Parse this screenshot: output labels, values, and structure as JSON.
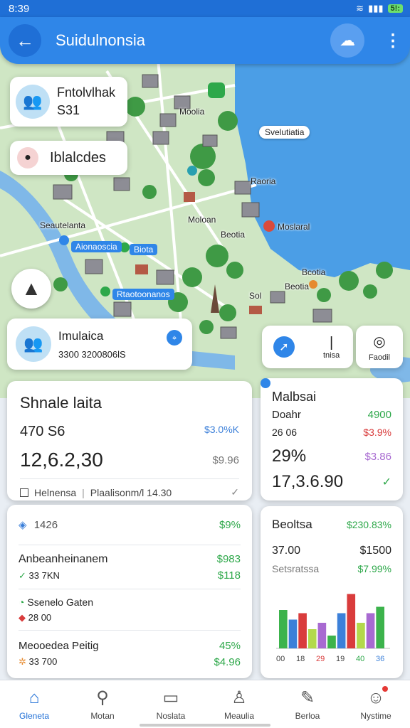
{
  "status": {
    "time": "8:39",
    "battery": "5!:"
  },
  "header": {
    "title": "Suidulnonsia"
  },
  "map": {
    "labels": [
      "Moolia",
      "Svelutiatia",
      "Raoria",
      "Moloan",
      "Beotia",
      "Moslaral",
      "Seautelanta",
      "Bcotia",
      "Beotia",
      "Sol"
    ],
    "pills": [
      "Aionaoscia",
      "Rtaotoonanos"
    ],
    "pill_small": "Biota"
  },
  "card_person": {
    "name": "Fntolvlhak",
    "value": "S31"
  },
  "card_place": {
    "name": "Iblalcdes"
  },
  "card_user": {
    "name": "Imulaica",
    "sub": "3300 3200806lS"
  },
  "card_right": {
    "label": "tnisa",
    "label2": "Faodil"
  },
  "summary": {
    "title": "Shnale laita",
    "row1_left": "470 S6",
    "row1_right": "$3.0%K",
    "big_value": "12,6.2,30",
    "big_right": "$9.96",
    "footer_left": "Helnensa",
    "footer_right": "Plaalisonm/l 14.30"
  },
  "market": {
    "title": "Malbsai",
    "line1_label": "Doahr",
    "line1_value": "4900",
    "line2_left": "26 06",
    "line2_right": "$3.9%",
    "percent": "29%",
    "percent_right": "$3.86",
    "big_value": "17,3.6.90"
  },
  "list": {
    "header_left": "1426",
    "header_right": "$9%",
    "items": [
      {
        "title": "Anbeanheinanem",
        "sub": "33 7KN",
        "v1": "$983",
        "v2": "$118"
      },
      {
        "title": "Ssenelo Gaten",
        "sub": "28 00",
        "v1": "",
        "v2": ""
      },
      {
        "title": "Meooedea Peitig",
        "sub": "33 700",
        "v1": "45%",
        "v2": "$4.96"
      }
    ]
  },
  "stats": {
    "title": "Beoltsa",
    "title_value": "$230.83%",
    "v1": "37.00",
    "v1_right": "$1500",
    "sub": "Setsratssa",
    "sub_right": "$7.99%",
    "axis": [
      "00",
      "18",
      "29",
      "19",
      "40",
      "36"
    ]
  },
  "chart_data": {
    "type": "bar",
    "categories": [
      "00",
      "18",
      "29",
      "19",
      "40",
      "36"
    ],
    "series": [
      {
        "values": [
          60,
          45,
          55,
          30,
          40,
          20,
          55,
          85,
          40,
          55,
          65
        ]
      }
    ],
    "colors": [
      "#3cb34c",
      "#3c80d9",
      "#d93c3c",
      "#b3d94c",
      "#a86ad1"
    ],
    "ylim": [
      0,
      100
    ]
  },
  "nav": [
    {
      "label": "Gleneta",
      "icon": "home-icon"
    },
    {
      "label": "Motan",
      "icon": "search-icon"
    },
    {
      "label": "Noslata",
      "icon": "chart-icon"
    },
    {
      "label": "Meaulia",
      "icon": "person-icon"
    },
    {
      "label": "Berloa",
      "icon": "edit-icon"
    },
    {
      "label": "Nystime",
      "icon": "profile-icon"
    }
  ]
}
